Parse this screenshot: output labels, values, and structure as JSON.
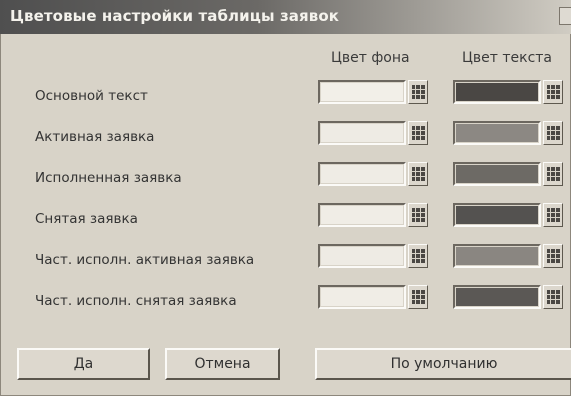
{
  "window": {
    "title": "Цветовые настройки таблицы заявок"
  },
  "columns": {
    "background": "Цвет фона",
    "text": "Цвет текста"
  },
  "rows": [
    {
      "label": "Основной текст",
      "bg_color": "#f2efe8",
      "text_color": "#4a4744"
    },
    {
      "label": "Активная заявка",
      "bg_color": "#eeebe4",
      "text_color": "#8c8883"
    },
    {
      "label": "Исполненная заявка",
      "bg_color": "#efece5",
      "text_color": "#6d6a65"
    },
    {
      "label": "Снятая заявка",
      "bg_color": "#f0ede6",
      "text_color": "#545250"
    },
    {
      "label": "Част. исполн. активная заявка",
      "bg_color": "#eeebe4",
      "text_color": "#8a8681"
    },
    {
      "label": "Част. исполн. снятая заявка",
      "bg_color": "#f0ede6",
      "text_color": "#5b5855"
    }
  ],
  "buttons": {
    "ok": "Да",
    "cancel": "Отмена",
    "default": "По умолчанию"
  }
}
